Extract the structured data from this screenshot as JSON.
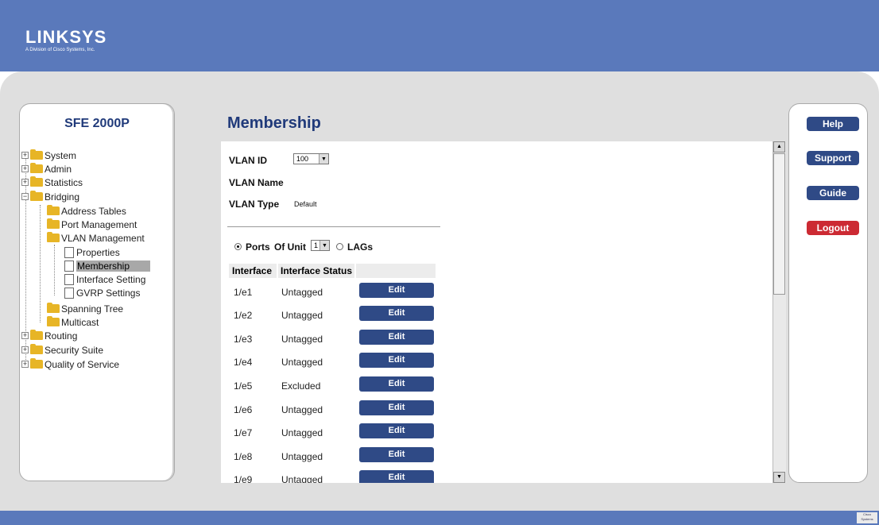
{
  "header": {
    "brand": "LINKSYS",
    "tagline": "A Division of Cisco Systems, Inc."
  },
  "nav": {
    "title": "SFE 2000P",
    "items": {
      "system": "System",
      "admin": "Admin",
      "statistics": "Statistics",
      "bridging": "Bridging",
      "address_tables": "Address Tables",
      "port_management": "Port Management",
      "vlan_management": "VLAN Management",
      "properties": "Properties",
      "membership": "Membership",
      "interface_setting": "Interface Setting",
      "gvrp_settings": "GVRP Settings",
      "spanning_tree": "Spanning Tree",
      "multicast": "Multicast",
      "routing": "Routing",
      "security_suite": "Security Suite",
      "qos": "Quality of Service"
    }
  },
  "main": {
    "title": "Membership",
    "vlan_id_label": "VLAN ID",
    "vlan_id_value": "100",
    "vlan_name_label": "VLAN Name",
    "vlan_type_label": "VLAN Type",
    "vlan_type_value": "Default",
    "ports_label": "Ports",
    "of_unit_label": "Of Unit",
    "unit_value": "1",
    "lags_label": "LAGs",
    "col_interface": "Interface",
    "col_status": "Interface Status",
    "edit_label": "Edit",
    "rows": [
      {
        "iface": "1/e1",
        "status": "Untagged"
      },
      {
        "iface": "1/e2",
        "status": "Untagged"
      },
      {
        "iface": "1/e3",
        "status": "Untagged"
      },
      {
        "iface": "1/e4",
        "status": "Untagged"
      },
      {
        "iface": "1/e5",
        "status": "Excluded"
      },
      {
        "iface": "1/e6",
        "status": "Untagged"
      },
      {
        "iface": "1/e7",
        "status": "Untagged"
      },
      {
        "iface": "1/e8",
        "status": "Untagged"
      },
      {
        "iface": "1/e9",
        "status": "Untagged"
      }
    ]
  },
  "right": {
    "help": "Help",
    "support": "Support",
    "guide": "Guide",
    "logout": "Logout"
  },
  "footer": {
    "cisco": "Cisco Systems"
  },
  "colors": {
    "header_blue": "#5a79bb",
    "button_navy": "#2f4a86",
    "logout_red": "#cc2a33",
    "title_navy": "#203a7a"
  }
}
